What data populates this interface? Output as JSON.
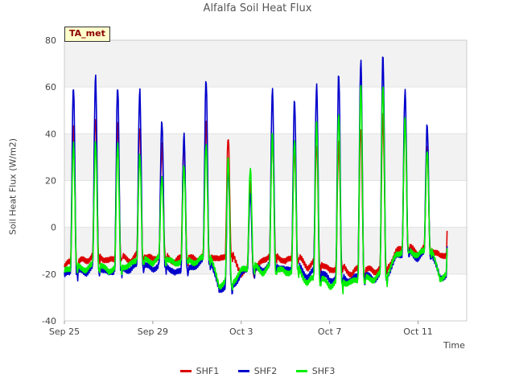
{
  "chart_data": {
    "type": "line",
    "title": "Alfalfa Soil Heat Flux",
    "xlabel": "Time",
    "ylabel": "Soil Heat Flux (W/m2)",
    "annotation": "TA_met",
    "ylim": [
      -40,
      80
    ],
    "yticks": [
      -40,
      -20,
      0,
      20,
      40,
      60,
      80
    ],
    "xlim_days": [
      0,
      18.2
    ],
    "xticks": [
      {
        "label": "Sep 25",
        "day": 0
      },
      {
        "label": "Sep 29",
        "day": 4
      },
      {
        "label": "Oct 3",
        "day": 8
      },
      {
        "label": "Oct 7",
        "day": 12
      },
      {
        "label": "Oct 11",
        "day": 16
      }
    ],
    "grid": true,
    "legend_position": "bottom",
    "series": [
      {
        "name": "SHF1",
        "color": "#dd0000",
        "peaks": [
          44,
          46,
          45,
          43,
          35,
          36,
          44,
          39,
          19,
          40,
          35,
          35,
          36,
          43,
          47,
          48,
          33,
          33
        ],
        "troughs": [
          -17,
          -14,
          -15,
          -14,
          -14,
          -15,
          -14,
          -14,
          -20,
          -14,
          -15,
          -17,
          -19,
          -20,
          -19,
          -11,
          -11,
          -13
        ]
      },
      {
        "name": "SHF2",
        "color": "#0000cc",
        "peaks": [
          61,
          64,
          60,
          59,
          45,
          40,
          63,
          26,
          15,
          58,
          55,
          61,
          65,
          72,
          73,
          59,
          44,
          33
        ],
        "troughs": [
          -21,
          -19,
          -20,
          -18,
          -18,
          -20,
          -16,
          -27,
          -20,
          -18,
          -19,
          -21,
          -23,
          -23,
          -22,
          -13,
          -13,
          -22
        ]
      },
      {
        "name": "SHF3",
        "color": "#00ee00",
        "peaks": [
          36,
          37,
          35,
          32,
          21,
          26,
          36,
          29,
          26,
          40,
          37,
          46,
          48,
          61,
          61,
          46,
          34,
          34
        ],
        "troughs": [
          -19,
          -18,
          -19,
          -16,
          -15,
          -16,
          -15,
          -25,
          -19,
          -19,
          -20,
          -24,
          -25,
          -24,
          -22,
          -12,
          -12,
          -22
        ]
      }
    ]
  }
}
